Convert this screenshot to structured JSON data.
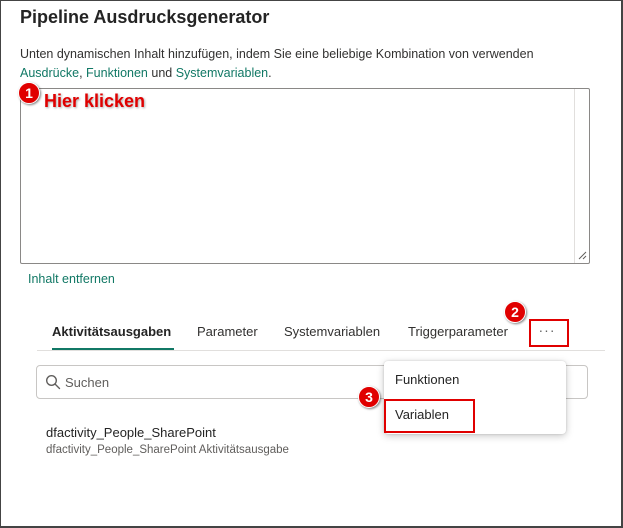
{
  "dialog": {
    "title": "Pipeline Ausdrucksgenerator",
    "description_prefix": "Unten dynamischen Inhalt hinzufügen, indem Sie eine beliebige Kombination von verwenden",
    "link_expressions": "Ausdrücke",
    "sep1": ",",
    "link_functions": "Funktionen",
    "and_word": "und",
    "link_sysvars": "Systemvariablen",
    "period": ".",
    "expression_value": "",
    "remove_content": "Inhalt entfernen"
  },
  "tabs": [
    {
      "label": "Aktivitätsausgaben",
      "active": true
    },
    {
      "label": "Parameter",
      "active": false
    },
    {
      "label": "Systemvariablen",
      "active": false
    },
    {
      "label": "Triggerparameter",
      "active": false
    }
  ],
  "more_button": {
    "label": "···",
    "icon": "ellipsis-icon"
  },
  "search": {
    "placeholder": "Suchen",
    "value": "",
    "icon": "search-icon"
  },
  "list": [
    {
      "title": "dfactivity_People_SharePoint",
      "subtitle": "dfactivity_People_SharePoint Aktivitätsausgabe"
    }
  ],
  "dropdown": {
    "items": [
      "Funktionen",
      "Variablen"
    ]
  },
  "annotations": {
    "callout_text": "Hier klicken",
    "badges": [
      "1",
      "2",
      "3"
    ],
    "color": "#e00000"
  },
  "colors": {
    "accent": "#117865",
    "annotation": "#e00000",
    "text": "#242424"
  }
}
